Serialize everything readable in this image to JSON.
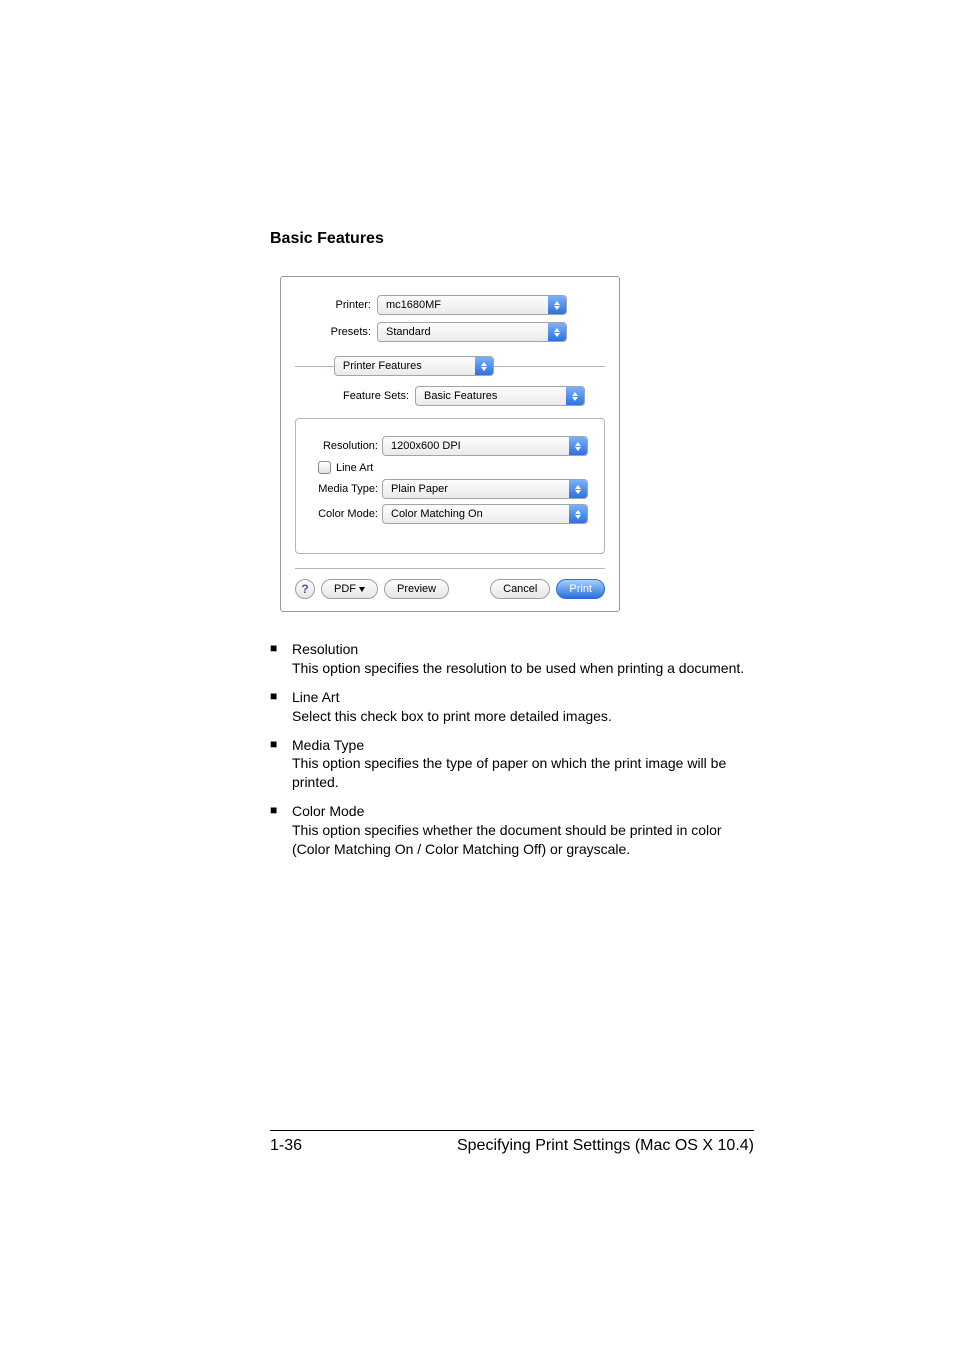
{
  "heading": "Basic Features",
  "dialog": {
    "printer_label": "Printer:",
    "printer_value": "mc1680MF",
    "presets_label": "Presets:",
    "presets_value": "Standard",
    "section_value": "Printer Features",
    "feature_sets_label": "Feature Sets:",
    "feature_sets_value": "Basic Features",
    "resolution_label": "Resolution:",
    "resolution_value": "1200x600 DPI",
    "line_art_label": "Line Art",
    "media_type_label": "Media Type:",
    "media_type_value": "Plain Paper",
    "color_mode_label": "Color Mode:",
    "color_mode_value": "Color Matching On",
    "help_glyph": "?",
    "pdf_button": "PDF",
    "preview_button": "Preview",
    "cancel_button": "Cancel",
    "print_button": "Print"
  },
  "bullets": [
    {
      "title": "Resolution",
      "desc": "This option specifies the resolution to be used when printing a document."
    },
    {
      "title": "Line Art",
      "desc": "Select this check box to print more detailed images."
    },
    {
      "title": "Media Type",
      "desc": "This option specifies the type of paper on which the print image will be printed."
    },
    {
      "title": "Color Mode",
      "desc": "This option specifies whether the document should be printed in color (Color Matching On / Color Matching Off) or grayscale."
    }
  ],
  "footer": {
    "page_num": "1-36",
    "title": "Specifying Print Settings (Mac OS X 10.4)"
  },
  "chart_data": {
    "type": "table",
    "title": "Print dialog — Printer Features / Basic Features",
    "rows": [
      {
        "field": "Printer",
        "value": "mc1680MF"
      },
      {
        "field": "Presets",
        "value": "Standard"
      },
      {
        "field": "Pane",
        "value": "Printer Features"
      },
      {
        "field": "Feature Sets",
        "value": "Basic Features"
      },
      {
        "field": "Resolution",
        "value": "1200x600 DPI"
      },
      {
        "field": "Line Art",
        "value": "unchecked"
      },
      {
        "field": "Media Type",
        "value": "Plain Paper"
      },
      {
        "field": "Color Mode",
        "value": "Color Matching On"
      }
    ]
  }
}
